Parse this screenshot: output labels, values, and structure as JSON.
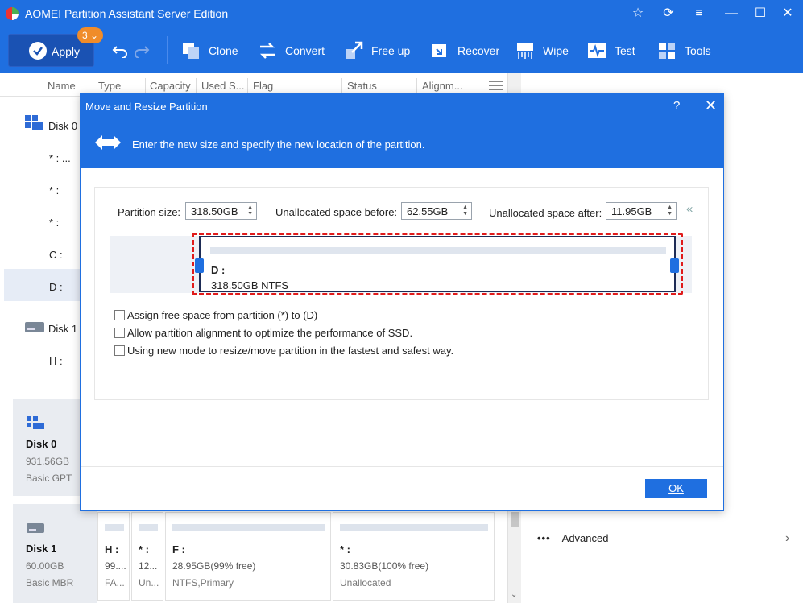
{
  "app": {
    "title": "AOMEI Partition Assistant Server Edition"
  },
  "toolbar": {
    "apply_label": "Apply",
    "pending_count": "3",
    "tools": [
      {
        "label": "Clone",
        "icon": "clone-icon"
      },
      {
        "label": "Convert",
        "icon": "convert-icon"
      },
      {
        "label": "Free up",
        "icon": "free-up-icon"
      },
      {
        "label": "Recover",
        "icon": "recover-icon"
      },
      {
        "label": "Wipe",
        "icon": "wipe-icon"
      },
      {
        "label": "Test",
        "icon": "test-icon"
      },
      {
        "label": "Tools",
        "icon": "tools-icon"
      }
    ]
  },
  "columns": [
    "Name",
    "Type",
    "Capacity",
    "Used S...",
    "Flag",
    "Status",
    "Alignm..."
  ],
  "tree": {
    "disk0": "Disk 0",
    "p1": "* : ...",
    "p2": "* :",
    "p3": "* :",
    "p4": "C :",
    "p5": "D :",
    "disk1": "Disk 1",
    "p6": "H :"
  },
  "disk_cards": [
    {
      "name": "Disk 0",
      "size": "931.56GB",
      "type": "Basic GPT"
    },
    {
      "name": "Disk 1",
      "size": "60.00GB",
      "type": "Basic MBR"
    }
  ],
  "partitions_disk1": [
    {
      "name": "H :",
      "size": "99....",
      "fs": "FA..."
    },
    {
      "name": "* :",
      "size": "12...",
      "fs": "Un..."
    },
    {
      "name": "F :",
      "size": "28.95GB(99% free)",
      "fs": "NTFS,Primary"
    },
    {
      "name": "* :",
      "size": "30.83GB(100% free)",
      "fs": "Unallocated"
    }
  ],
  "side": {
    "advanced_label": "Advanced"
  },
  "dialog": {
    "title": "Move and Resize Partition",
    "help": "?",
    "close": "✕",
    "instruction": "Enter the new size and specify the new location of the partition.",
    "partition_size_label": "Partition size:",
    "partition_size_value": "318.50GB",
    "unalloc_before_label": "Unallocated space before:",
    "unalloc_before_value": "62.55GB",
    "unalloc_after_label": "Unallocated space after:",
    "unalloc_after_value": "11.95GB",
    "partition_name": "D :",
    "partition_desc": "318.50GB NTFS",
    "options": [
      "Assign free space from partition (*) to (D)",
      "Allow partition alignment to optimize the performance of SSD.",
      "Using new mode to resize/move partition in the fastest and safest way."
    ],
    "ok_label": "OK"
  }
}
